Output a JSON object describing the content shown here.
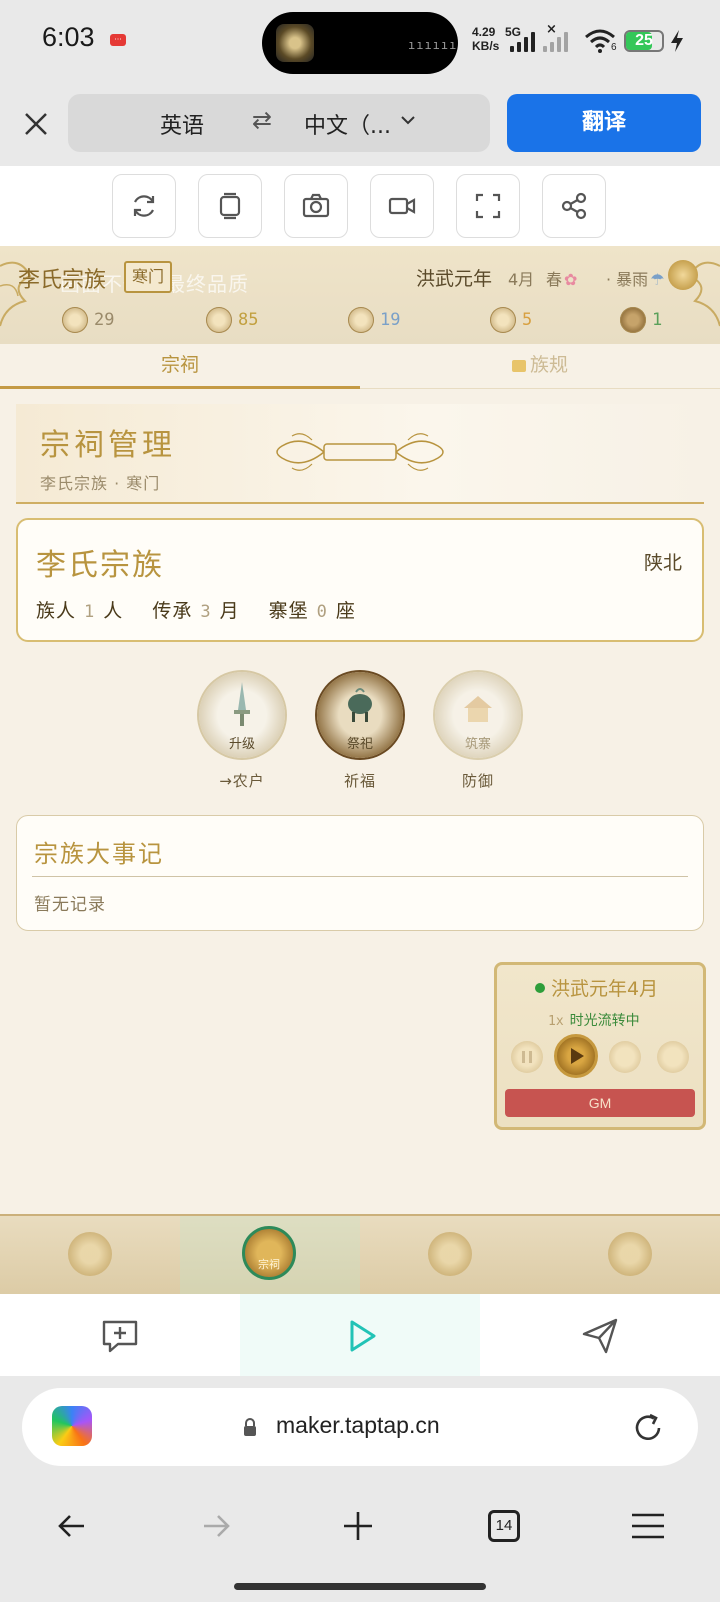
{
  "status": {
    "time": "6:03",
    "net_speed_value": "4.29",
    "net_speed_unit": "KB/s",
    "net_type": "5G",
    "battery": "25",
    "wifi_sub": "6"
  },
  "translate_bar": {
    "source_lang": "英语",
    "swap_icon": "⇄",
    "target_lang": "中文（...",
    "translate_button": "翻译"
  },
  "game": {
    "clan_name": "李氏宗族",
    "rank": "寒门",
    "watermark": "画面不代表最终品质",
    "era": "洪武元年",
    "month": "4月",
    "season": "春",
    "weather": "· 暴雨",
    "resources": [
      {
        "icon": "silver-icon",
        "value": "29",
        "color": "#9a8a6a"
      },
      {
        "icon": "grain-icon",
        "value": "85",
        "color": "#c2a040"
      },
      {
        "icon": "cloth-icon",
        "value": "19",
        "color": "#7aa0c8"
      },
      {
        "icon": "prestige-icon",
        "value": "5",
        "color": "#d8a040"
      },
      {
        "icon": "people-icon",
        "value": "1",
        "color": "#5aa05a"
      }
    ],
    "tabs": [
      {
        "label": "宗祠",
        "active": true
      },
      {
        "label": "族规",
        "locked": true
      }
    ],
    "panel": {
      "title": "宗祠管理",
      "subtitle": "李氏宗族 · 寒门"
    },
    "clan_card": {
      "name": "李氏宗族",
      "region": "陕北",
      "members_label": "族人",
      "members_value": "1",
      "members_unit": "人",
      "heritage_label": "传承",
      "heritage_value": "3",
      "heritage_unit": "月",
      "forts_label": "寨堡",
      "forts_value": "0",
      "forts_unit": "座"
    },
    "actions": [
      {
        "inner": "升级",
        "label": "→农户"
      },
      {
        "inner": "祭祀",
        "label": "祈福"
      },
      {
        "inner": "筑寨",
        "label": "防御"
      }
    ],
    "events": {
      "title": "宗族大事记",
      "empty": "暂无记录"
    },
    "time_widget": {
      "date": "洪武元年4月",
      "speed": "1x",
      "status": "时光流转中",
      "gm": "GM"
    },
    "nav": [
      {
        "icon": "book-icon"
      },
      {
        "icon": "ancestral-hall-icon",
        "label": "宗祠",
        "active": true
      },
      {
        "icon": "family-members-icon"
      },
      {
        "icon": "map-scroll-icon"
      }
    ]
  },
  "browser": {
    "url": "maker.taptap.cn",
    "tab_count": "14"
  }
}
